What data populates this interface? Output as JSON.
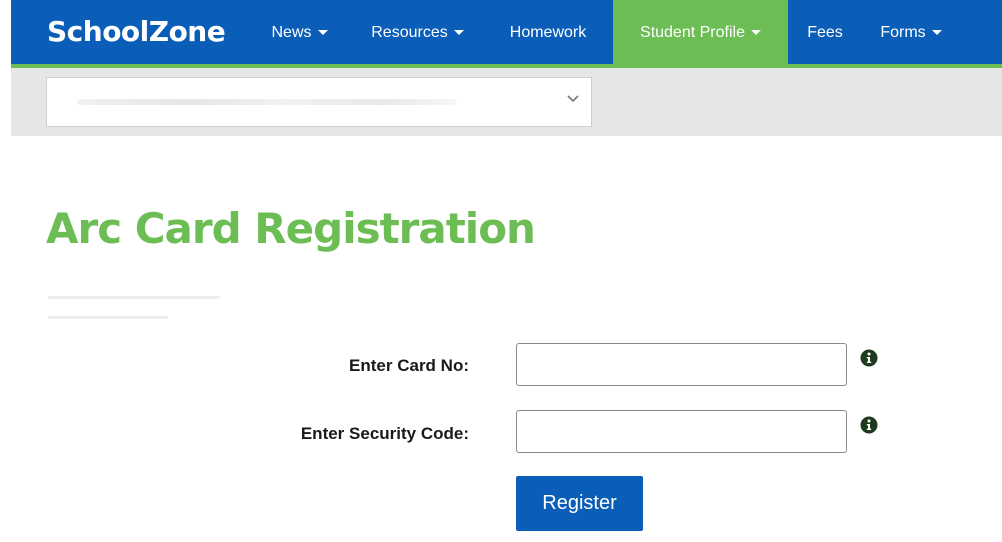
{
  "header": {
    "brand": "SchoolZone",
    "nav": [
      {
        "label": "News",
        "dropdown": true,
        "active": false
      },
      {
        "label": "Resources",
        "dropdown": true,
        "active": false
      },
      {
        "label": "Homework",
        "dropdown": false,
        "active": false
      },
      {
        "label": "Student Profile",
        "dropdown": true,
        "active": true
      },
      {
        "label": "Fees",
        "dropdown": false,
        "active": false
      },
      {
        "label": "Forms",
        "dropdown": true,
        "active": false
      }
    ]
  },
  "subbar": {
    "select_value": ""
  },
  "main": {
    "title": "Arc Card Registration",
    "form": {
      "card_no_label": "Enter Card No:",
      "card_no_value": "",
      "security_code_label": "Enter Security Code:",
      "security_code_value": "",
      "register_label": "Register"
    }
  },
  "colors": {
    "brand_blue": "#0a5eb8",
    "accent_green": "#6cbd54",
    "subbar_gray": "#e6e6e6"
  },
  "icons": [
    "chevron-down-icon",
    "info-icon"
  ]
}
